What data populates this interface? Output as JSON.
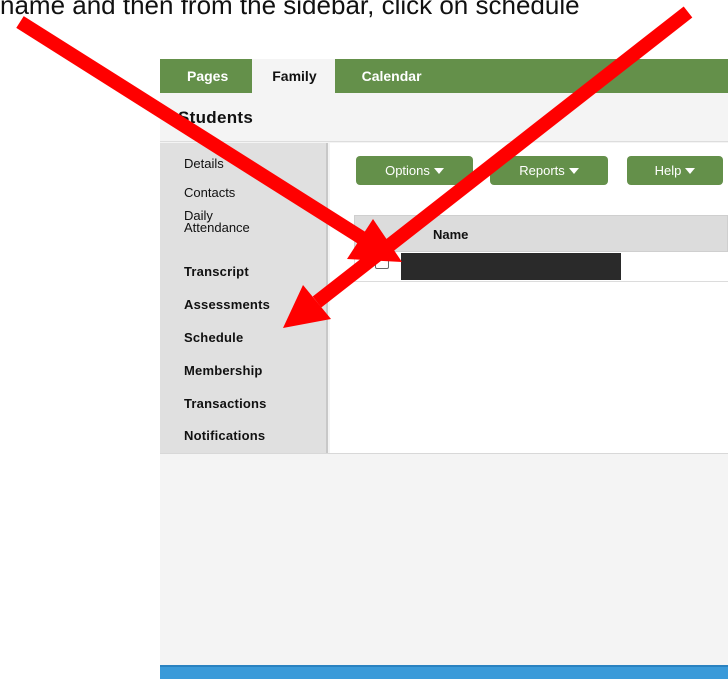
{
  "instruction": {
    "text": "name and then from the sidebar, click on schedule"
  },
  "nav": {
    "tabs": [
      {
        "label": "Pages"
      },
      {
        "label": "Family"
      },
      {
        "label": "Calendar"
      }
    ],
    "active_tab": "Family"
  },
  "page": {
    "title": "Students"
  },
  "sidebar": {
    "items": [
      {
        "label": "Details"
      },
      {
        "label": "Contacts"
      },
      {
        "label": "Daily Attendance"
      },
      {
        "label": "Transcript"
      },
      {
        "label": "Assessments"
      },
      {
        "label": "Schedule"
      },
      {
        "label": "Membership"
      },
      {
        "label": "Transactions"
      },
      {
        "label": "Notifications"
      }
    ]
  },
  "toolbar": {
    "options_label": "Options",
    "reports_label": "Reports",
    "help_label": "Help"
  },
  "table": {
    "columns": [
      "Name"
    ],
    "rows": [
      {
        "name": "[redacted]",
        "checked": false
      }
    ]
  },
  "annotation": {
    "arrow_color": "#ff0000",
    "arrow_count": 2
  },
  "colors": {
    "nav_green": "#64904a",
    "footer_blue": "#3a9ad9",
    "sidebar_gray": "#e0e0e0"
  }
}
